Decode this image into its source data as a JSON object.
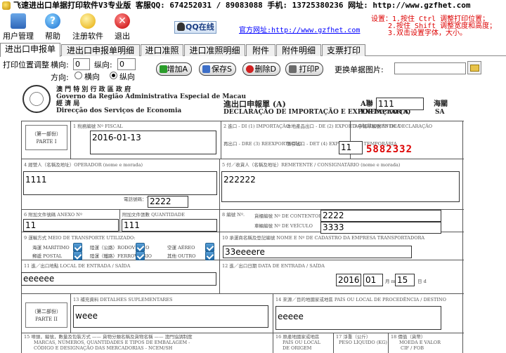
{
  "title_bar": "飞速进出口单据打印软件V3专业版 客服QQ: 674252031 / 89083088 手机: 13725380236 网址: http://www.gzfhet.com",
  "toolbar": {
    "user_mgmt": "用户管理",
    "help": "帮助",
    "register": "注册软件",
    "exit": "退出",
    "qq_online": "QQ在线",
    "site_link": "官方网址:http://www.gzfhet.com",
    "hint_line1": "设置：1.按住 Ctrl  调整打印位置；",
    "hint_line2": "2.按住 Shift 调整宽度和高度；",
    "hint_line3": "3.双击设置字体，大小。"
  },
  "tabs": [
    "进出口申报单",
    "进出口申报单明细",
    "进口准照",
    "进口准照明细",
    "附件",
    "附件明细",
    "支票打印"
  ],
  "controls": {
    "print_pos_label": "打印位置调整",
    "horizontal_label": "横向:",
    "horizontal_value": "0",
    "vertical_label": "纵向:",
    "vertical_value": "0",
    "direction_label": "方向:",
    "landscape": "横向",
    "portrait": "纵向",
    "portrait_selected": true,
    "add": "增加A",
    "save": "保存S",
    "delete": "删除D",
    "print": "打印P",
    "replace_image_label": "更换单据图片:"
  },
  "doc": {
    "gov_line1": "澳 門 特 別 行 政 區 政 府",
    "gov_line2": "Governo da Região Administrativa Especial de Macau",
    "gov_line3": "經 濟 局",
    "gov_line4": "Direcção dos Serviços de Economia",
    "title_cn": "進出口申報單 (A)",
    "title_pt": "DECLARAÇÃO DE IMPORTAÇÃO E EXPORTAÇÃO (A)",
    "copy_label_cn": "A聯",
    "copy_label_pt": "EXEMPLAR A",
    "copy_value": "111",
    "customs_cn": "海關",
    "customs_pt": "SA",
    "part1_cn": "（第一部份）",
    "part1_pt": "PARTE I",
    "part2_cn": "（第二部份）",
    "part2_pt": "PARTE II",
    "lbl_fiscal": "1  稅務編號  Nº FISCAL",
    "fiscal_value": "2016-01-13",
    "lbl_import": "2 進口 - DI (1)   IMPORTAÇÃO",
    "lbl_export": "本地產品出口 - DE (2)   EXPORTAÇÃO DOMÉSTICA",
    "lbl_reexport": "再出口 - DRE (3)   REEXPORTAÇÃO",
    "lbl_temp_export": "暫時出口 - DET (4)   EXPORTAÇÃO TEMPORÁRIA",
    "lbl_decl_no": "3  申報單編號  Nº DE DECLARAÇÃO",
    "decl_prefix_value": "11",
    "decl_number": "5882332",
    "lbl_operator": "4  經營人（名稱及地址）OPERADOR (nome e morada)",
    "operator_value": "1111",
    "lbl_sender": "5  付／收貨人（名稱及地址）REMETENTE / CONSIGNATÁRIO (nome e morada)",
    "sender_value": "222222",
    "lbl_phone": "電話號碼：TEL. Nº.",
    "phone_value": "2222",
    "lbl_annex": "6  附加文件號碼  ANEXO Nº",
    "annex_value": "11",
    "lbl_annex_qty": "附加文件張數  QUANTIDADE",
    "annex_qty_value": "111",
    "lbl_reg_no": "8  編號 Nº.",
    "lbl_container": "貨櫃編號  Nº DE CONTENTOR",
    "container_value": "2222",
    "lbl_vehicle": "車輛編號  Nº DE VEÍCULO",
    "vehicle_value": "3333",
    "lbl_transport": "9  運輸方式  MEIO DE TRANSPORTE UTILIZADO:",
    "lbl_maritime": "海運 MARÍTIMO",
    "lbl_road": "陸運（公路）RODOVIÁRIO",
    "lbl_air": "空運 AÉREO",
    "lbl_postal": "郵遞 POSTAL",
    "lbl_rail": "陸運（鐵路）FERROVIÁRIO",
    "lbl_other": "其他 OUTRO",
    "lbl_carrier": "10  承運商名稱及登記編號  NOME E Nº DE CADASTRO DA EMPRESA TRANSPORTADORA",
    "carrier_value": "33eeeere",
    "lbl_entry": "11  進／出口地點  LOCAL DE ENTRADA / SAÍDA",
    "entry_value": "eeeeee",
    "lbl_date": "12  進／出口日期  DATA DE ENTRADA / SAÍDA",
    "date_year": "2016",
    "date_month": "01",
    "month_label": "月 m",
    "date_day": "15",
    "day_label": "日 d",
    "lbl_details": "13  補充資料  DETALHES SUPLEMENTARES",
    "details_value": "weee",
    "lbl_origin": "14  來源／目的地國家或地區  PAÍS OU LOCAL DE PROCEDÊNCIA / DESTINO",
    "origin_value": "eeeee",
    "lbl_marks": "15  嘜頭，編號，數量及包裝方式 —— 貨物分類名稱及貨物名稱 —— 澳門協調制度",
    "lbl_marks2": "MARCAS, NÚMEROS, QUANTIDADES E TIPOS DE EMBALAGEM -",
    "lbl_marks3": "CÓDIGO E DESIGNAÇÃO DAS MERCADORIAS - NCEM/SH",
    "lbl_origin_place": "16  原產地國家或地區",
    "lbl_origin_place2": "PAÍS OU LOCAL",
    "lbl_origin_place3": "DE ORIGEM",
    "lbl_net_weight": "17  淨重（公斤）",
    "lbl_net_weight2": "PESO LÍQUIDO (KG)",
    "lbl_value": "18  價值（貨幣）",
    "lbl_value2": "MOEDA E VALOR",
    "lbl_value3": "CIF / FOB"
  }
}
